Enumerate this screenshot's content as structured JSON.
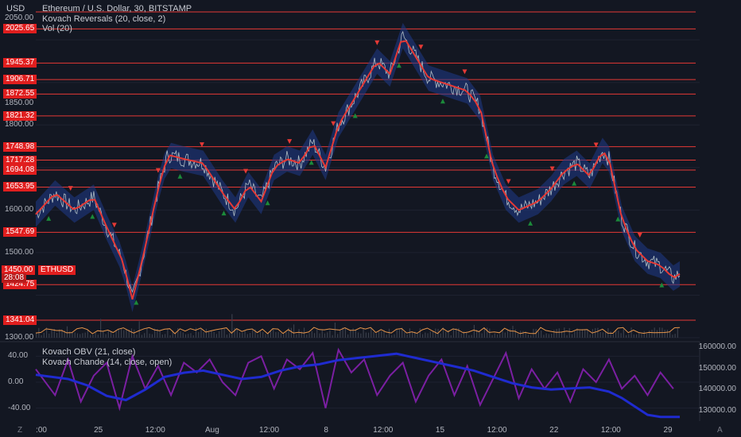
{
  "header": {
    "currency": "USD",
    "symbol_line": "Ethereum / U.S. Dollar, 30, BITSTAMP",
    "indicator_1": "Kovach Reversals (20, close, 2)",
    "indicator_2": "Vol (20)"
  },
  "lower_pane": {
    "indicator_1": "Kovach OBV (21, close)",
    "indicator_2": "Kovach Chande (14, close, open)"
  },
  "price_axis_labels": [
    "2050.00",
    "1850.00",
    "1800.00",
    "1600.00",
    "1500.00",
    "1300.00"
  ],
  "level_tags": [
    "2025.65",
    "1945.37",
    "1906.71",
    "1872.55",
    "1821.32",
    "1748.98",
    "1717.28",
    "1694.08",
    "1653.95",
    "1547.69",
    "1424.75",
    "1341.04"
  ],
  "current_price": {
    "value": "1450.00",
    "countdown": "28:08",
    "ticker": "ETHUSD"
  },
  "oscillator_labels": [
    "40.00",
    "0.00",
    "-40.00"
  ],
  "obv_axis_labels": [
    "160000.00",
    "150000.00",
    "140000.00",
    "130000.00"
  ],
  "x_labels": [
    ":00",
    "25",
    "12:00",
    "Aug",
    "12:00",
    "8",
    "12:00",
    "15",
    "12:00",
    "22",
    "12:00",
    "29"
  ],
  "corner_left": "Z",
  "corner_right": "A",
  "chart_data": {
    "type": "line",
    "title": "Ethereum / U.S. Dollar, 30, BITSTAMP",
    "ylabel": "USD",
    "price_ylim": [
      1300,
      2075
    ],
    "price_path": {
      "x": [
        0,
        0.03,
        0.06,
        0.09,
        0.11,
        0.135,
        0.15,
        0.165,
        0.19,
        0.205,
        0.23,
        0.26,
        0.29,
        0.31,
        0.33,
        0.35,
        0.37,
        0.39,
        0.41,
        0.43,
        0.45,
        0.47,
        0.49,
        0.51,
        0.53,
        0.55,
        0.57,
        0.59,
        0.61,
        0.63,
        0.65,
        0.67,
        0.69,
        0.71,
        0.73,
        0.75,
        0.78,
        0.8,
        0.82,
        0.84,
        0.86,
        0.88,
        0.89,
        0.91,
        0.93,
        0.95,
        0.97,
        0.99,
        1.0
      ],
      "y": [
        1590,
        1640,
        1600,
        1630,
        1560,
        1480,
        1390,
        1480,
        1650,
        1730,
        1720,
        1710,
        1640,
        1600,
        1660,
        1620,
        1700,
        1720,
        1710,
        1760,
        1700,
        1800,
        1850,
        1900,
        1950,
        1920,
        2010,
        1960,
        1910,
        1900,
        1890,
        1880,
        1840,
        1700,
        1630,
        1600,
        1620,
        1650,
        1690,
        1710,
        1680,
        1740,
        1720,
        1580,
        1510,
        1480,
        1470,
        1440,
        1450
      ]
    },
    "volume_ylim": [
      0,
      1
    ],
    "lower_pane": {
      "chande": {
        "name": "Kovach Chande (14, close, open)",
        "ylim": [
          -60,
          60
        ],
        "x": [
          0,
          0.03,
          0.05,
          0.07,
          0.09,
          0.11,
          0.13,
          0.15,
          0.17,
          0.19,
          0.21,
          0.23,
          0.25,
          0.27,
          0.29,
          0.31,
          0.33,
          0.35,
          0.37,
          0.39,
          0.41,
          0.43,
          0.45,
          0.47,
          0.49,
          0.51,
          0.53,
          0.55,
          0.57,
          0.59,
          0.61,
          0.63,
          0.65,
          0.67,
          0.69,
          0.71,
          0.73,
          0.75,
          0.77,
          0.79,
          0.81,
          0.83,
          0.85,
          0.87,
          0.89,
          0.91,
          0.93,
          0.95,
          0.97,
          0.99
        ],
        "y": [
          20,
          -20,
          35,
          -30,
          10,
          30,
          -40,
          40,
          -10,
          25,
          -20,
          30,
          15,
          35,
          0,
          -20,
          30,
          40,
          -10,
          35,
          20,
          45,
          -40,
          50,
          15,
          35,
          -20,
          10,
          30,
          -30,
          10,
          35,
          -20,
          25,
          -35,
          5,
          45,
          -25,
          20,
          -10,
          15,
          -30,
          20,
          0,
          35,
          -10,
          10,
          -20,
          15,
          -10
        ]
      },
      "obv": {
        "name": "Kovach OBV (21, close)",
        "ylim": [
          125000,
          162000
        ],
        "x": [
          0,
          0.05,
          0.08,
          0.11,
          0.14,
          0.17,
          0.2,
          0.23,
          0.26,
          0.29,
          0.32,
          0.35,
          0.38,
          0.41,
          0.44,
          0.47,
          0.5,
          0.53,
          0.56,
          0.59,
          0.62,
          0.65,
          0.68,
          0.71,
          0.74,
          0.77,
          0.8,
          0.83,
          0.86,
          0.89,
          0.91,
          0.93,
          0.95,
          0.97,
          1.0
        ],
        "y": [
          147000,
          145000,
          142000,
          137000,
          135000,
          140000,
          146000,
          148000,
          149000,
          147000,
          145000,
          146000,
          149000,
          151000,
          152000,
          154000,
          155000,
          156000,
          157000,
          155000,
          153000,
          151000,
          149000,
          146000,
          143000,
          141000,
          140000,
          140500,
          141000,
          139000,
          136000,
          132000,
          128000,
          127000,
          127000
        ]
      }
    }
  }
}
